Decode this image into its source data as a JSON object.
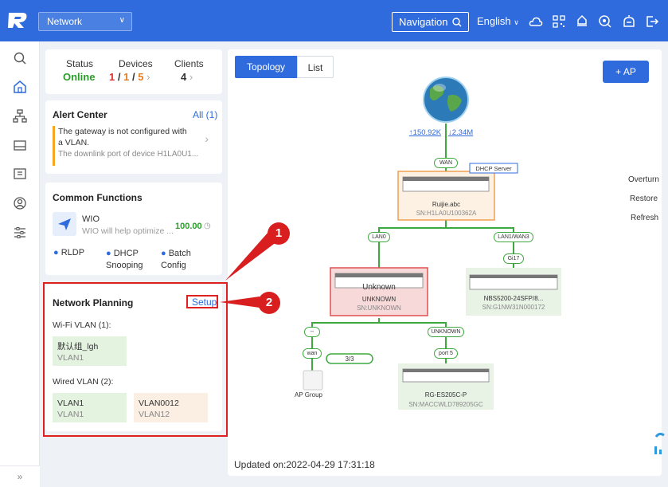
{
  "topbar": {
    "network_label": "Network",
    "navigation_label": "Navigation",
    "language": "English"
  },
  "status_card": {
    "status_label": "Status",
    "status_value": "Online",
    "devices_label": "Devices",
    "devices_a": "1",
    "devices_b": "1",
    "devices_c": "5",
    "clients_label": "Clients",
    "clients_value": "4"
  },
  "alert_center": {
    "title": "Alert Center",
    "all_link": "All (1)",
    "message": "The gateway is not configured with a VLAN.",
    "detail": "The downlink port of device H1LA0U1..."
  },
  "common_functions": {
    "title": "Common Functions",
    "wio_name": "WIO",
    "wio_desc": "WIO will help optimize ...",
    "wio_score": "100.00",
    "items": [
      {
        "label": "RLDP"
      },
      {
        "label": "DHCP\nSnooping"
      },
      {
        "label": "Batch\nConfig"
      }
    ]
  },
  "network_planning": {
    "title": "Network Planning",
    "setup_link": "Setup",
    "wifi_label": "Wi-Fi VLAN (1):",
    "wifi_vlans": [
      {
        "name": "默认组_lgh",
        "id": "VLAN1"
      }
    ],
    "wired_label": "Wired VLAN (2):",
    "wired_vlans": [
      {
        "name": "VLAN1",
        "id": "VLAN1"
      },
      {
        "name": "VLAN0012",
        "id": "VLAN12"
      }
    ]
  },
  "callouts": [
    "1",
    "2"
  ],
  "topology": {
    "tabs": [
      "Topology",
      "List"
    ],
    "add_ap": "+ AP",
    "upload": "↑150.92K",
    "download": "↓2.34M",
    "wan_tag": "WAN",
    "dhcp_tag": "DHCP Server",
    "gateway_name": "Ruijie.abc",
    "gateway_sn": "SN:H1LA0U100362A",
    "lan0": "LAN0",
    "lan1": "LAN1/WAN3",
    "g17": "Gi17",
    "unknown_title": "Unknown",
    "unknown_name": "UNKNOWN",
    "unknown_sn": "SN:UNKNOWN",
    "nbs_name": "NBS5200-24SFP/8...",
    "nbs_sn": "SN:G1NW31N000172",
    "dash": "--",
    "unknown_tag": "UNKNOWN",
    "wan_small": "wan",
    "ratio": "3/3",
    "port5": "port 5",
    "ap_group": "AP Group",
    "es_name": "RG-ES205C-P",
    "es_sn": "SN:MACCWLD789205GC",
    "side_buttons": [
      "Overturn",
      "Restore",
      "Refresh"
    ],
    "updated": "Updated on:2022-04-29 17:31:18"
  }
}
